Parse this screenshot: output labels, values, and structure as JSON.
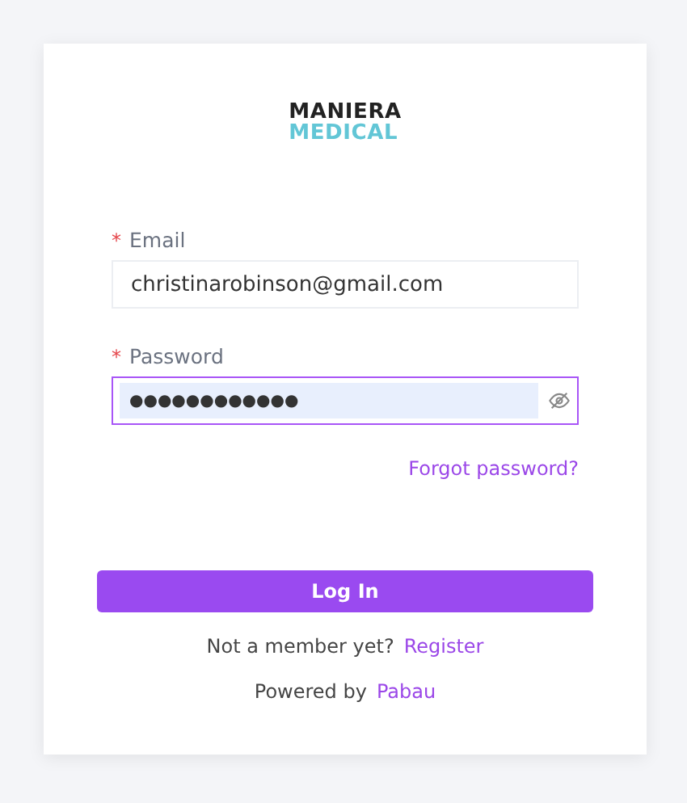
{
  "logo": {
    "line_1": "MANIERA",
    "line_2": "MEDICAL"
  },
  "fields": [
    {
      "kind": "text",
      "required_mark": "*",
      "label": "Email",
      "value": "christinarobinson@gmail.com",
      "focused": false
    },
    {
      "kind": "password",
      "required_mark": "*",
      "label": "Password",
      "value": "●●●●●●●●●●●●",
      "focused": true
    }
  ],
  "forgot_link": "Forgot password?",
  "login_button": "Log In",
  "register": {
    "prompt": "Not a member yet?",
    "link": "Register"
  },
  "footer": {
    "prefix": "Powered by",
    "link": "Pabau"
  }
}
